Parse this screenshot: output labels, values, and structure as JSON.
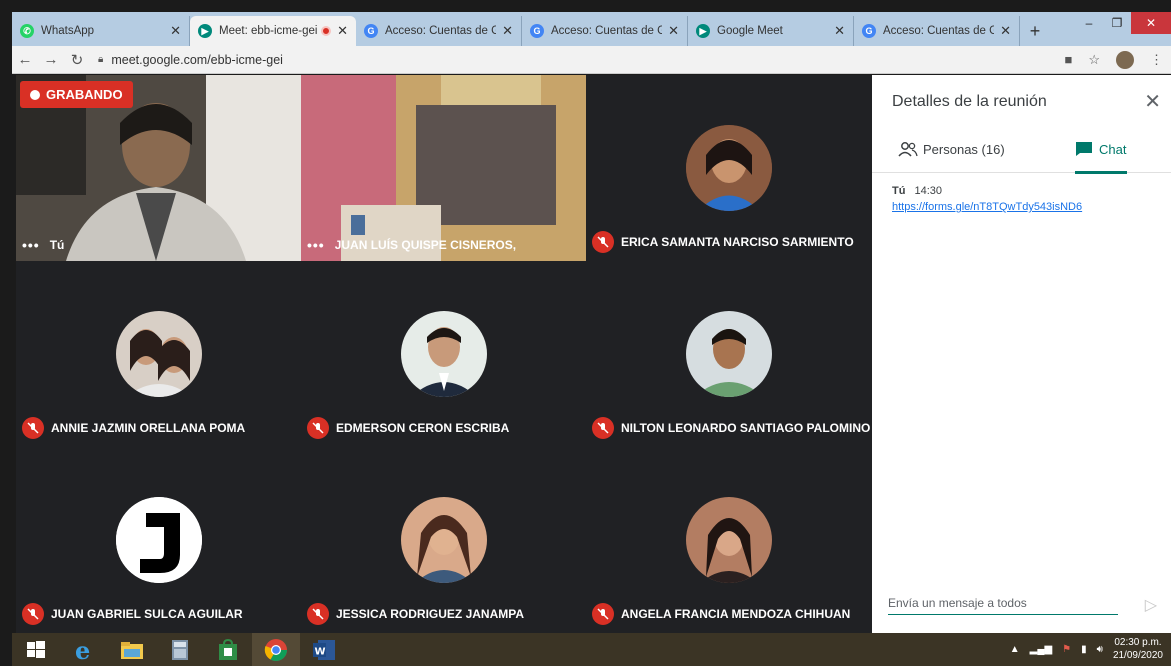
{
  "browser": {
    "tabs": [
      {
        "label": "WhatsApp",
        "favicon_color": "#25d366",
        "active": false
      },
      {
        "label": "Meet: ebb-icme-gei",
        "favicon_color": "#00897b",
        "active": true,
        "recording": true
      },
      {
        "label": "Acceso: Cuentas de Goo",
        "favicon_color": "#4285f4",
        "active": false
      },
      {
        "label": "Acceso: Cuentas de Goo",
        "favicon_color": "#4285f4",
        "active": false
      },
      {
        "label": "Google Meet",
        "favicon_color": "#00897b",
        "active": false
      },
      {
        "label": "Acceso: Cuentas de Goo",
        "favicon_color": "#4285f4",
        "active": false
      }
    ],
    "url": "meet.google.com/ebb-icme-gei"
  },
  "meeting": {
    "recording_label": "GRABANDO",
    "participants": [
      {
        "name": "Tú",
        "muted": false,
        "video": true
      },
      {
        "name": "JUAN LUÍS QUISPE CISNEROS,",
        "muted": false,
        "video": true
      },
      {
        "name": "ERICA SAMANTA NARCISO SARMIENTO",
        "muted": true,
        "video": false
      },
      {
        "name": "ANNIE JAZMIN ORELLANA POMA",
        "muted": true,
        "video": false
      },
      {
        "name": "EDMERSON CERON ESCRIBA",
        "muted": true,
        "video": false
      },
      {
        "name": "NILTON LEONARDO SANTIAGO PALOMINO",
        "muted": true,
        "video": false
      },
      {
        "name": "JUAN GABRIEL SULCA AGUILAR",
        "muted": true,
        "video": false
      },
      {
        "name": "JESSICA RODRIGUEZ JANAMPA",
        "muted": true,
        "video": false
      },
      {
        "name": "ANGELA FRANCIA MENDOZA CHIHUAN",
        "muted": true,
        "video": false
      }
    ]
  },
  "panel": {
    "title": "Detalles de la reunión",
    "people_tab": "Personas (16)",
    "chat_tab": "Chat",
    "message": {
      "author": "Tú",
      "time": "14:30",
      "link": "https://forms.gle/nT8TQwTdy543isND6"
    },
    "compose_placeholder": "Envía un mensaje a todos"
  },
  "taskbar": {
    "time": "02:30 p.m.",
    "date": "21/09/2020"
  },
  "colors": {
    "meet_red": "#d93025",
    "meet_teal": "#00796b",
    "grid_bg": "#202124",
    "tile_bg": "#3c4043"
  }
}
